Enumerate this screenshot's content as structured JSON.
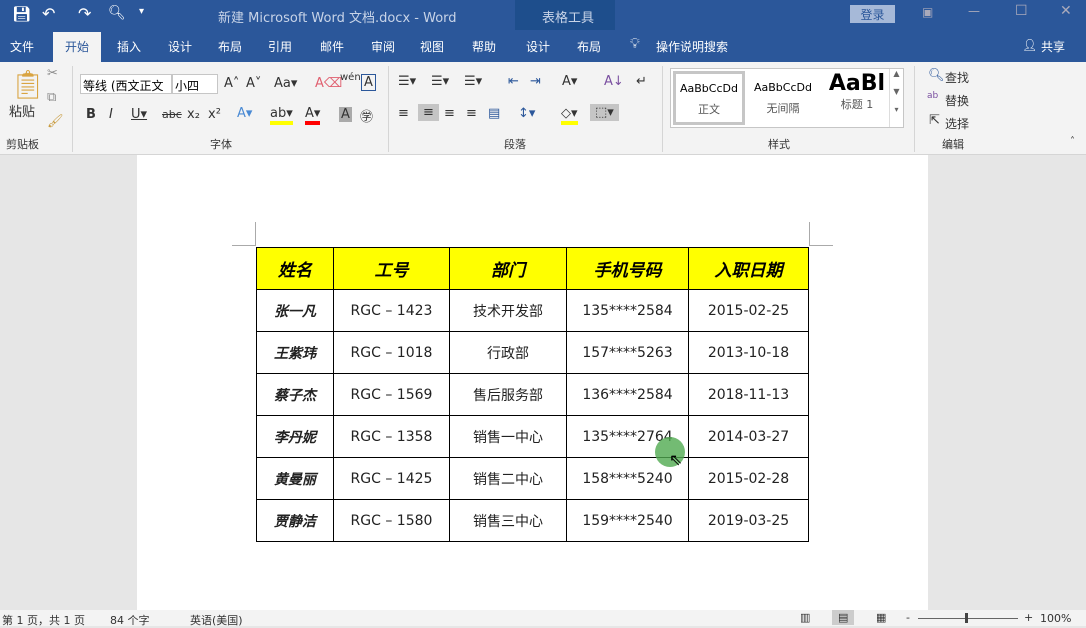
{
  "title": {
    "doc": "新建 Microsoft Word 文档.docx  -  Word",
    "context": "表格工具",
    "login": "登录"
  },
  "tabs": [
    "文件",
    "开始",
    "插入",
    "设计",
    "布局",
    "引用",
    "邮件",
    "审阅",
    "视图",
    "帮助",
    "设计",
    "布局"
  ],
  "search": "操作说明搜索",
  "share": "共享",
  "ribbon": {
    "paste": "粘贴",
    "clipboard": "剪贴板",
    "font_name": "等线 (西文正文",
    "font_size": "小四",
    "font": "字体",
    "paragraph": "段落",
    "styles_group": "样式",
    "editing": "编辑",
    "styles": [
      {
        "preview": "AaBbCcDd",
        "name": "正文"
      },
      {
        "preview": "AaBbCcDd",
        "name": "无间隔"
      },
      {
        "preview": "AaBl",
        "name": "标题 1"
      }
    ],
    "find": "查找",
    "replace": "替换",
    "select": "选择"
  },
  "table": {
    "headers": [
      "姓名",
      "工号",
      "部门",
      "手机号码",
      "入职日期"
    ],
    "rows": [
      [
        "张一凡",
        "RGC – 1423",
        "技术开发部",
        "135****2584",
        "2015-02-25"
      ],
      [
        "王紫玮",
        "RGC – 1018",
        "行政部",
        "157****5263",
        "2013-10-18"
      ],
      [
        "蔡子杰",
        "RGC – 1569",
        "售后服务部",
        "136****2584",
        "2018-11-13"
      ],
      [
        "李丹妮",
        "RGC – 1358",
        "销售一中心",
        "135****2764",
        "2014-03-27"
      ],
      [
        "黄曼丽",
        "RGC – 1425",
        "销售二中心",
        "158****5240",
        "2015-02-28"
      ],
      [
        "贾静洁",
        "RGC – 1580",
        "销售三中心",
        "159****2540",
        "2019-03-25"
      ]
    ]
  },
  "status": {
    "page": "第 1 页，共 1 页",
    "words": "84 个字",
    "lang": "英语(美国)",
    "zoom": "100%"
  },
  "colors": {
    "brand": "#2b579a",
    "header_fill": "#ffff00"
  }
}
